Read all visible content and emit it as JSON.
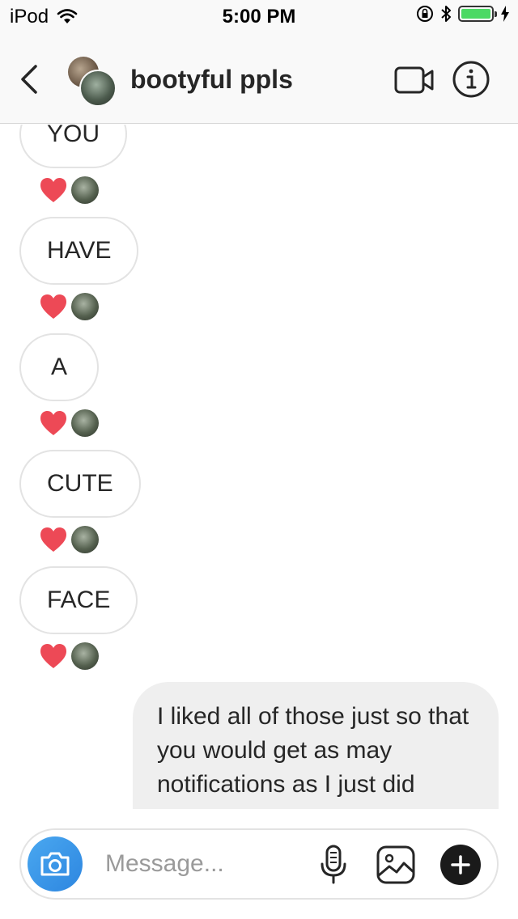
{
  "status_bar": {
    "device": "iPod",
    "time": "5:00 PM",
    "battery_color": "#4cd964"
  },
  "header": {
    "title": "bootyful ppls",
    "icons": [
      "chevron-left-icon",
      "video-call-icon",
      "info-icon"
    ]
  },
  "messages": [
    {
      "direction": "incoming",
      "text": "YOU",
      "reaction": "heart"
    },
    {
      "direction": "incoming",
      "text": "HAVE",
      "reaction": "heart"
    },
    {
      "direction": "incoming",
      "text": "A",
      "reaction": "heart"
    },
    {
      "direction": "incoming",
      "text": "CUTE",
      "reaction": "heart"
    },
    {
      "direction": "incoming",
      "text": "FACE",
      "reaction": "heart"
    },
    {
      "direction": "outgoing",
      "text": "I liked all of those just so that you would get as may notifications as I just did"
    }
  ],
  "composer": {
    "placeholder": "Message...",
    "icons": [
      "camera-icon",
      "microphone-icon",
      "gallery-icon",
      "plus-icon"
    ],
    "camera_color": "#3897f0"
  },
  "colors": {
    "heart": "#ed4956",
    "incoming_border": "#e3e3e3",
    "outgoing_bg": "#efefef"
  }
}
